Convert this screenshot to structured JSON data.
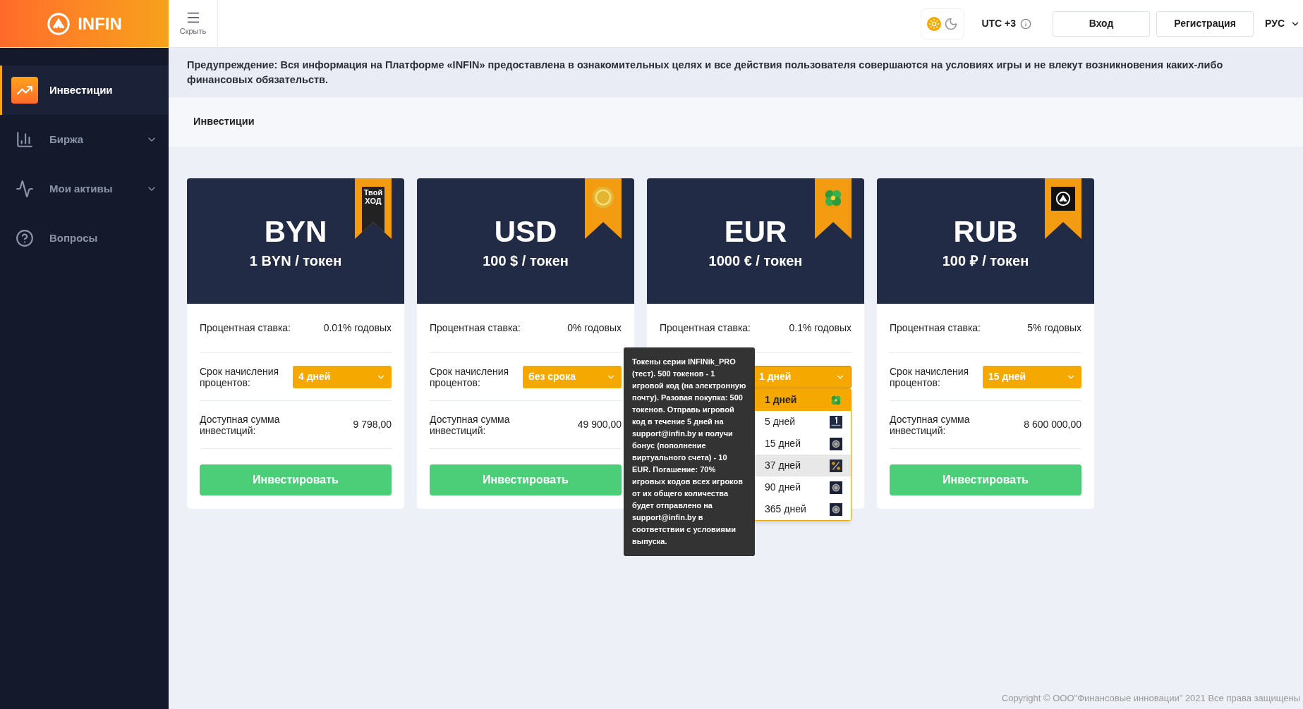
{
  "header": {
    "logo": "INFIN",
    "hide_label": "Скрыть",
    "dark_theme": false,
    "timezone": "UTC +3",
    "login": "Вход",
    "register": "Регистрация",
    "language": "РУС"
  },
  "sidebar": {
    "items": [
      {
        "label": "Инвестиции",
        "selected": true,
        "kind": "link"
      },
      {
        "label": "Биржа",
        "selected": false,
        "kind": "group"
      },
      {
        "label": "Мои активы",
        "selected": false,
        "kind": "group"
      },
      {
        "label": "Вопросы",
        "selected": false,
        "kind": "link"
      }
    ]
  },
  "warning": "Предупреждение: Вся информация на Платформе «INFIN» предоставлена в ознакомительных целях и все действия пользователя совершаются на условиях игры и не влекут возникновения каких-либо финансовых обязательств.",
  "breadcrumb": "Инвестиции",
  "cards": [
    {
      "currency": "BYN",
      "price": "1 BYN / токен",
      "badge_text": "Твой ХОД",
      "rate_label": "Процентная ставка:",
      "rate": "0.01% годовых",
      "term_label": "Срок начисления процентов:",
      "term": "4 дней",
      "sum_label": "Доступная сумма инвестиций:",
      "sum": "9 798,00",
      "button": "Инвестировать"
    },
    {
      "currency": "USD",
      "price": "100 $ / токен",
      "rate_label": "Процентная ставка:",
      "rate": "0% годовых",
      "term_label": "Срок начисления процентов:",
      "term": "без срока",
      "sum_label": "Доступная сумма инвестиций:",
      "sum": "49 900,00",
      "button": "Инвестировать"
    },
    {
      "currency": "EUR",
      "price": "1000 € / токен",
      "rate_label": "Процентная ставка:",
      "rate": "0.1% годовых",
      "term": "1 дней",
      "term_options": [
        {
          "label": "1 дней",
          "selected": true,
          "highlighted": false,
          "kind": "clover"
        },
        {
          "label": "5 дней",
          "selected": false,
          "highlighted": false,
          "kind": "win"
        },
        {
          "label": "15 дней",
          "selected": false,
          "highlighted": false,
          "kind": "logo"
        },
        {
          "label": "37 дней",
          "selected": false,
          "highlighted": true,
          "kind": "percent"
        },
        {
          "label": "90 дней",
          "selected": false,
          "highlighted": false,
          "kind": "logo"
        },
        {
          "label": "365 дней",
          "selected": false,
          "highlighted": false,
          "kind": "logo"
        }
      ],
      "tooltip": "Токены серии INFINik_PRO (тест). 500 токенов - 1 игровой код (на электронную почту). Разовая покупка: 500 токенов. Отправь игровой код в течение 5 дней на support@infin.by и получи бонус (пополнение виртуального счета) - 10 EUR. Погашение: 70% игровых кодов всех игроков от их общего количества будет отправлено на support@infin.by в соответствии с условиями выпуска."
    },
    {
      "currency": "RUB",
      "price": "100 ₽ / токен",
      "rate_label": "Процентная ставка:",
      "rate": "5% годовых",
      "term_label": "Срок начисления процентов:",
      "term": "15 дней",
      "sum_label": "Доступная сумма инвестиций:",
      "sum": "8 600 000,00",
      "button": "Инвестировать"
    }
  ],
  "footer": "Copyright © ООО\"Финансовые инновации\" 2021 Все права защищены"
}
